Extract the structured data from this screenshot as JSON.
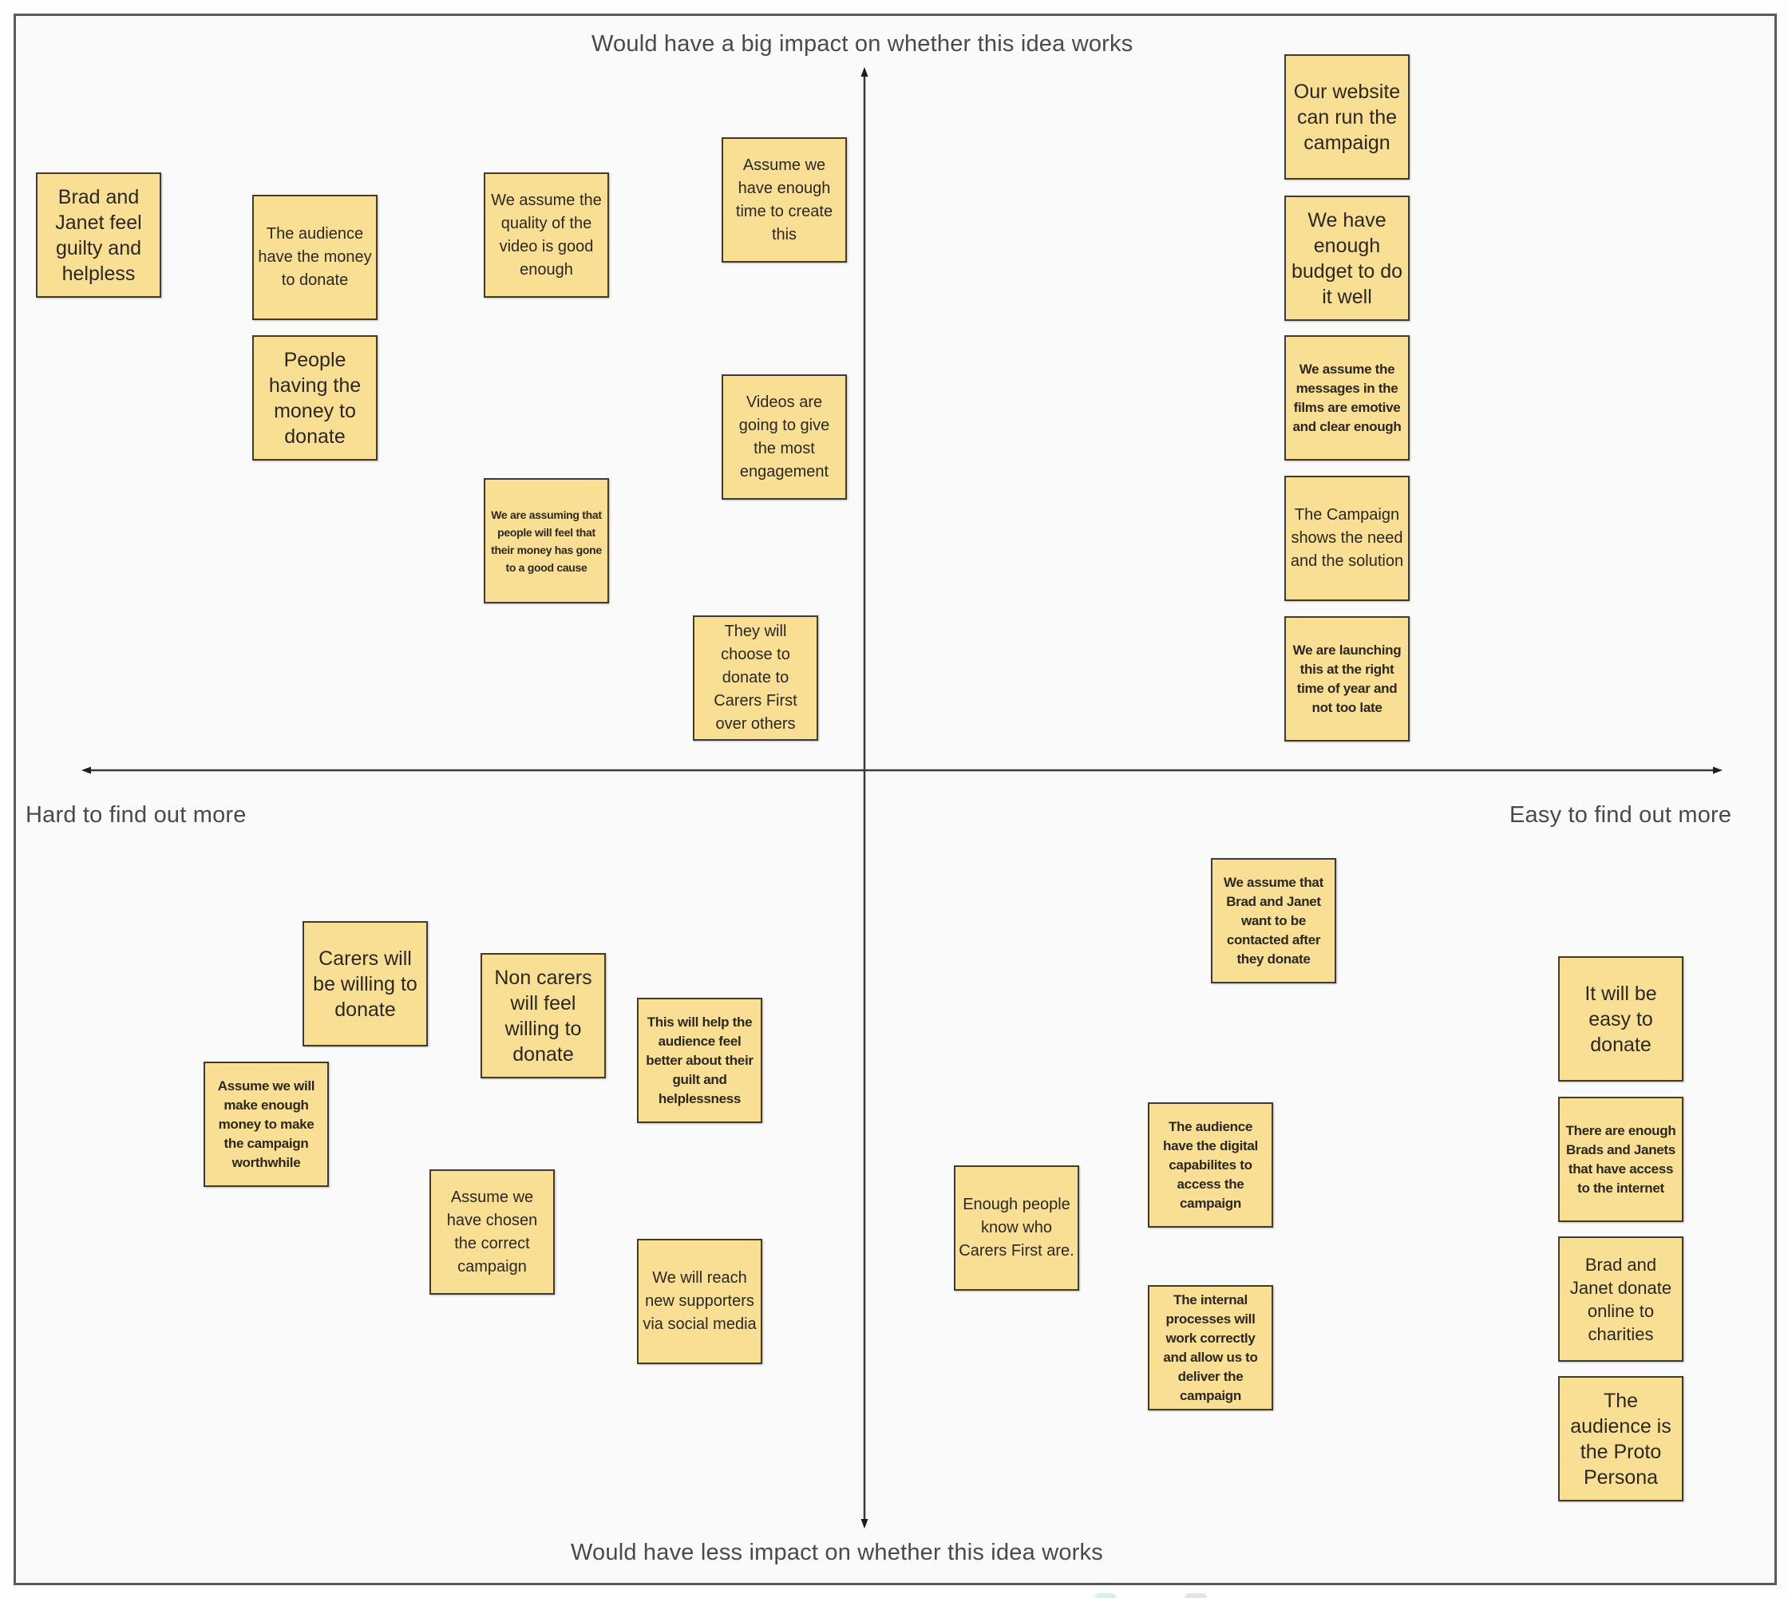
{
  "axes": {
    "top_label": "Would have a big impact on whether this idea works",
    "bottom_label": "Would have less impact on whether this idea works",
    "left_label": "Hard to find out more",
    "right_label": "Easy to find out more"
  },
  "colors": {
    "note_fill": "#f9df93",
    "note_border": "#3f3a32",
    "axis_line": "#3a3a3a",
    "label_text": "#4a4a4a",
    "board_bg": "#fafafa"
  },
  "quadrants": {
    "top_left": {
      "name": "Big impact / Hard to find out more",
      "notes": [
        {
          "text": "Brad and Janet feel guilty and helpless",
          "size": "xl"
        },
        {
          "text": "The audience have the money to donate",
          "size": "md"
        },
        {
          "text": "People having the money to donate",
          "size": "xl"
        },
        {
          "text": "We assume the quality of the video is good enough",
          "size": "md"
        },
        {
          "text": "We are assuming that people will feel that their money has gone to a good cause",
          "size": "xs"
        },
        {
          "text": "Assume we have enough time to create this",
          "size": "md"
        },
        {
          "text": "Videos are going to give the most engagement",
          "size": "md"
        },
        {
          "text": "They will choose to donate to Carers First over others",
          "size": "md"
        }
      ]
    },
    "top_right": {
      "name": "Big impact / Easy to find out more",
      "notes": [
        {
          "text": "Our website can run the campaign",
          "size": "xl"
        },
        {
          "text": "We have enough budget to do it well",
          "size": "xl"
        },
        {
          "text": "We assume the messages in the films are emotive and clear enough",
          "size": "sm"
        },
        {
          "text": "The Campaign shows the need and the solution",
          "size": "md"
        },
        {
          "text": "We are launching this at the right time of year and not too late",
          "size": "sm"
        }
      ]
    },
    "bottom_left": {
      "name": "Less impact / Hard to find out more",
      "notes": [
        {
          "text": "Carers will be willing to donate",
          "size": "xl"
        },
        {
          "text": "Non carers will feel willing to donate",
          "size": "xl"
        },
        {
          "text": "This will help the audience feel better about their guilt and helplessness",
          "size": "sm"
        },
        {
          "text": "Assume we will make enough money to make the campaign worthwhile",
          "size": "sm"
        },
        {
          "text": "Assume we have chosen the correct campaign",
          "size": "md"
        },
        {
          "text": "We will reach new supporters via social media",
          "size": "md"
        }
      ]
    },
    "bottom_right": {
      "name": "Less impact / Easy to find out more",
      "notes": [
        {
          "text": "We assume that Brad and Janet want to be contacted after they donate",
          "size": "sm"
        },
        {
          "text": "Enough people know who Carers First are.",
          "size": "md"
        },
        {
          "text": "The audience have the digital capabilites to access the campaign",
          "size": "sm"
        },
        {
          "text": "The internal processes will work correctly and allow us to deliver the campaign",
          "size": "sm"
        },
        {
          "text": "It will be easy to donate",
          "size": "xl"
        },
        {
          "text": "There are enough Brads and Janets that have access to the internet",
          "size": "sm"
        },
        {
          "text": "Brad and Janet donate online to charities",
          "size": "lg"
        },
        {
          "text": "The audience is the Proto Persona",
          "size": "xl"
        }
      ]
    }
  }
}
